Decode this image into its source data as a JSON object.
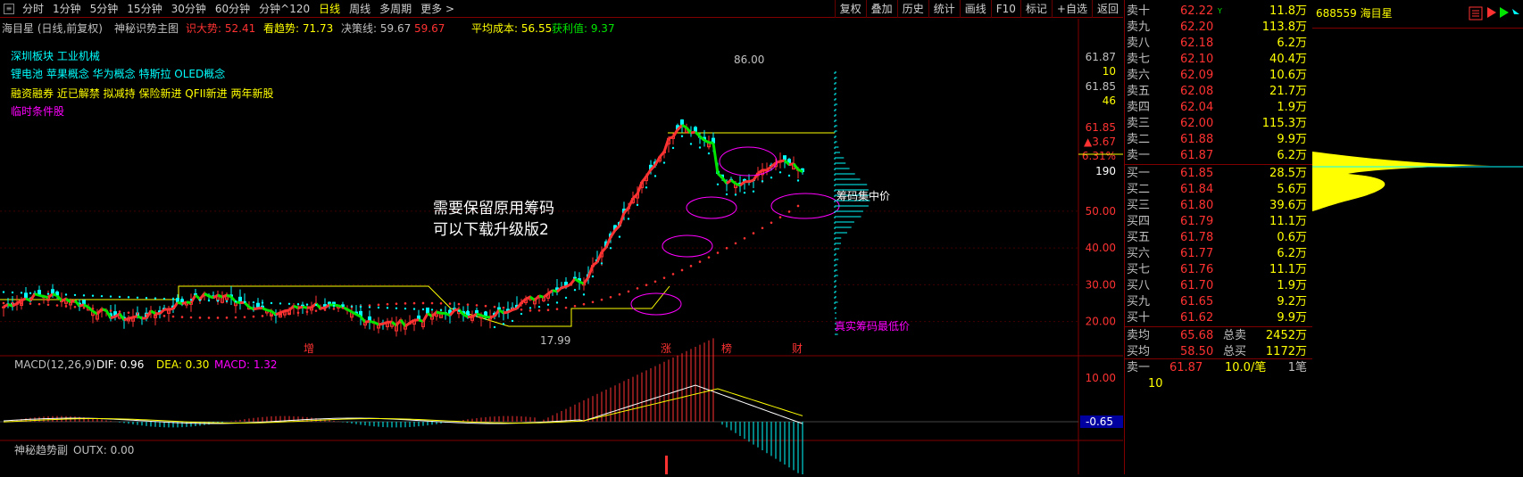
{
  "toolbar": {
    "periods": [
      "分时",
      "1分钟",
      "5分钟",
      "15分钟",
      "30分钟",
      "60分钟",
      "分钟^120",
      "日线",
      "周线",
      "多周期",
      "更多 >"
    ],
    "active_period": "日线",
    "actions": [
      "复权",
      "叠加",
      "历史",
      "统计",
      "画线",
      "F10",
      "标记",
      "+自选",
      "返回"
    ]
  },
  "chart_header": {
    "stock": "海目星 (日线,前复权)",
    "indicator": "神秘识势主图",
    "sell_label": "识大势: 52.41",
    "trend_label": "看趋势: 71.73",
    "decision_label": "决策线: 59.67",
    "decision_value": "59.67",
    "avg_cost_label": "平均成本: 56.55",
    "profit_label": "获利值: 9.37"
  },
  "concepts": {
    "line1": "深圳板块  工业机械",
    "line2": "锂电池  苹果概念  华为概念  特斯拉  OLED概念",
    "line3": "融资融券  近已解禁  拟减持  保险新进  QFII新进  两年新股",
    "line4": "临时条件股"
  },
  "annotations": {
    "note1": "需要保留原用筹码",
    "note2": "可以下载升级版2",
    "chip_center": "筹码集中价",
    "real_low": "真实筹码最低价",
    "high_mark": "86.00",
    "low_mark": "17.99",
    "markers": [
      "增",
      "涨",
      "榜",
      "财"
    ]
  },
  "price_axis": {
    "top_value": "61.87",
    "top_count": "10",
    "second_value": "61.85",
    "second_count": "46",
    "current_price": "61.85",
    "change": "▲3.67",
    "change_pct": "6.31%",
    "volume_level": "190",
    "ticks": [
      "50.00",
      "40.00",
      "30.00",
      "20.00"
    ]
  },
  "macd": {
    "label": "MACD(12,26,9)",
    "dif": "DIF: 0.96",
    "dea": "DEA: 0.30",
    "macd": "MACD: 1.32",
    "tick_top": "10.00",
    "tick_current": "-0.65"
  },
  "sub_indicator": {
    "label": "神秘趋势副",
    "value": "OUTX: 0.00"
  },
  "quote": {
    "stock_id": "688559 海目星",
    "sells": [
      {
        "label": "卖十",
        "mark": "Y",
        "price": "62.22",
        "vol": "11.8万"
      },
      {
        "label": "卖九",
        "mark": "",
        "price": "62.20",
        "vol": "113.8万"
      },
      {
        "label": "卖八",
        "mark": "",
        "price": "62.18",
        "vol": "6.2万"
      },
      {
        "label": "卖七",
        "mark": "",
        "price": "62.10",
        "vol": "40.4万"
      },
      {
        "label": "卖六",
        "mark": "",
        "price": "62.09",
        "vol": "10.6万"
      },
      {
        "label": "卖五",
        "mark": "",
        "price": "62.08",
        "vol": "21.7万"
      },
      {
        "label": "卖四",
        "mark": "",
        "price": "62.04",
        "vol": "1.9万"
      },
      {
        "label": "卖三",
        "mark": "",
        "price": "62.00",
        "vol": "115.3万"
      },
      {
        "label": "卖二",
        "mark": "",
        "price": "61.88",
        "vol": "9.9万"
      },
      {
        "label": "卖一",
        "mark": "",
        "price": "61.87",
        "vol": "6.2万"
      }
    ],
    "buys": [
      {
        "label": "买一",
        "price": "61.85",
        "vol": "28.5万"
      },
      {
        "label": "买二",
        "price": "61.84",
        "vol": "5.6万"
      },
      {
        "label": "买三",
        "price": "61.80",
        "vol": "39.6万"
      },
      {
        "label": "买四",
        "price": "61.79",
        "vol": "11.1万"
      },
      {
        "label": "买五",
        "price": "61.78",
        "vol": "0.6万"
      },
      {
        "label": "买六",
        "price": "61.77",
        "vol": "6.2万"
      },
      {
        "label": "买七",
        "price": "61.76",
        "vol": "11.1万"
      },
      {
        "label": "买八",
        "price": "61.70",
        "vol": "1.9万"
      },
      {
        "label": "买九",
        "price": "61.65",
        "vol": "9.2万"
      },
      {
        "label": "买十",
        "price": "61.62",
        "vol": "9.9万"
      }
    ],
    "summary": [
      {
        "label": "卖均",
        "price": "65.68",
        "sub": "总卖",
        "vol": "2452万"
      },
      {
        "label": "买均",
        "price": "58.50",
        "sub": "总买",
        "vol": "1172万"
      }
    ],
    "tick": {
      "label": "卖一",
      "price": "61.87",
      "qty": "10.0/笔",
      "n": "1笔",
      "extra": "10"
    }
  },
  "colors": {
    "red": "#ff3232",
    "yellow": "#ffff00",
    "green": "#00e600",
    "cyan": "#00ffff",
    "magenta": "#ff00ff",
    "border": "#800000"
  }
}
